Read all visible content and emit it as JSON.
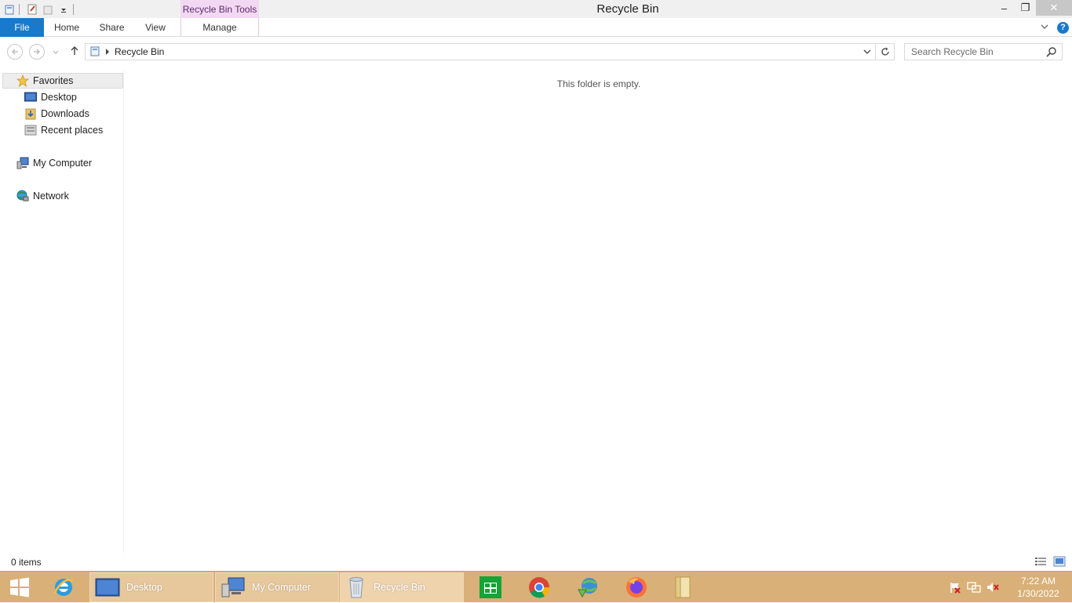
{
  "window": {
    "title": "Recycle Bin",
    "context_tab_group": "Recycle Bin Tools",
    "minimize_glyph": "–",
    "restore_glyph": "❐",
    "close_glyph": "✕"
  },
  "ribbon": {
    "tabs": [
      {
        "label": "File"
      },
      {
        "label": "Home"
      },
      {
        "label": "Share"
      },
      {
        "label": "View"
      },
      {
        "label": "Manage"
      }
    ],
    "help_label": "?"
  },
  "address": {
    "path": "Recycle Bin",
    "search_placeholder": "Search Recycle Bin"
  },
  "nav_pane": {
    "items": [
      {
        "label": "Favorites",
        "icon": "star-icon"
      },
      {
        "label": "Desktop",
        "icon": "desktop-icon"
      },
      {
        "label": "Downloads",
        "icon": "downloads-icon"
      },
      {
        "label": "Recent places",
        "icon": "recent-places-icon"
      },
      {
        "label": "My Computer",
        "icon": "computer-icon"
      },
      {
        "label": "Network",
        "icon": "network-icon"
      }
    ]
  },
  "content": {
    "empty_message": "This folder is empty."
  },
  "status": {
    "item_count": "0 items"
  },
  "taskbar": {
    "windows": [
      {
        "label": "Desktop",
        "icon": "desktop-icon"
      },
      {
        "label": "My Computer",
        "icon": "computer-icon"
      },
      {
        "label": "Recycle Bin",
        "icon": "recycle-bin-icon"
      }
    ],
    "pinned": [
      "store-icon",
      "chrome-icon",
      "download-manager-icon",
      "firefox-icon",
      "file-explorer-icon"
    ],
    "clock_time": "7:22 AM",
    "clock_date": "1/30/2022"
  },
  "colors": {
    "accent": "#1979ca",
    "taskbar": "#d8b078",
    "context_tab": "#f2d8f2"
  }
}
